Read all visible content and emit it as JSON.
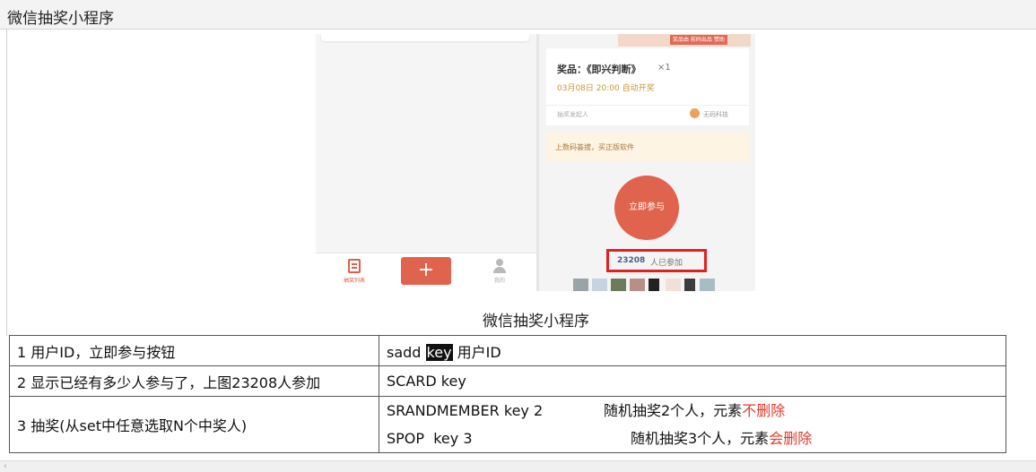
{
  "window": {
    "title": "微信抽奖小程序"
  },
  "screenshot": {
    "prize_title": "奖品：《即兴判断》",
    "prize_count": "×1",
    "prize_time": "03月08日 20:00 自动开奖",
    "sponsor_label": "抽奖发起人",
    "sponsor_name": "无码科技",
    "banner_tags": "奖品由 前码出品 赞助",
    "note_text": "上数码荟拔，买正版软件",
    "join_label": "立即参与",
    "participant_count": "23208",
    "participant_suffix": "人已参加",
    "tab_list_label": "抽奖列表",
    "plus_label": "+",
    "tab_me_label": "我的"
  },
  "caption": "微信抽奖小程序",
  "table": {
    "rows": [
      {
        "left": "1 用户ID，立即参与按钮",
        "cmd_a": "sadd ",
        "cmd_key": "key",
        "cmd_b": " 用户ID"
      },
      {
        "left": "2 显示已经有多少人参与了，上图23208人参加",
        "cmd": "SCARD key"
      },
      {
        "left": "3 抽奖(从set中任意选取N个中奖人)",
        "line1_cmd": "SRANDMEMBER key 2",
        "line1_desc": "随机抽奖2个人，元素",
        "line1_red": "不删除",
        "line2_cmd": "SPOP  key 3",
        "line2_desc": "随机抽奖3个人，元素",
        "line2_red": "会删除"
      }
    ]
  },
  "colors": {
    "accent": "#e0634d",
    "highlight_box": "#e32020",
    "red_text": "#e23a2a"
  }
}
